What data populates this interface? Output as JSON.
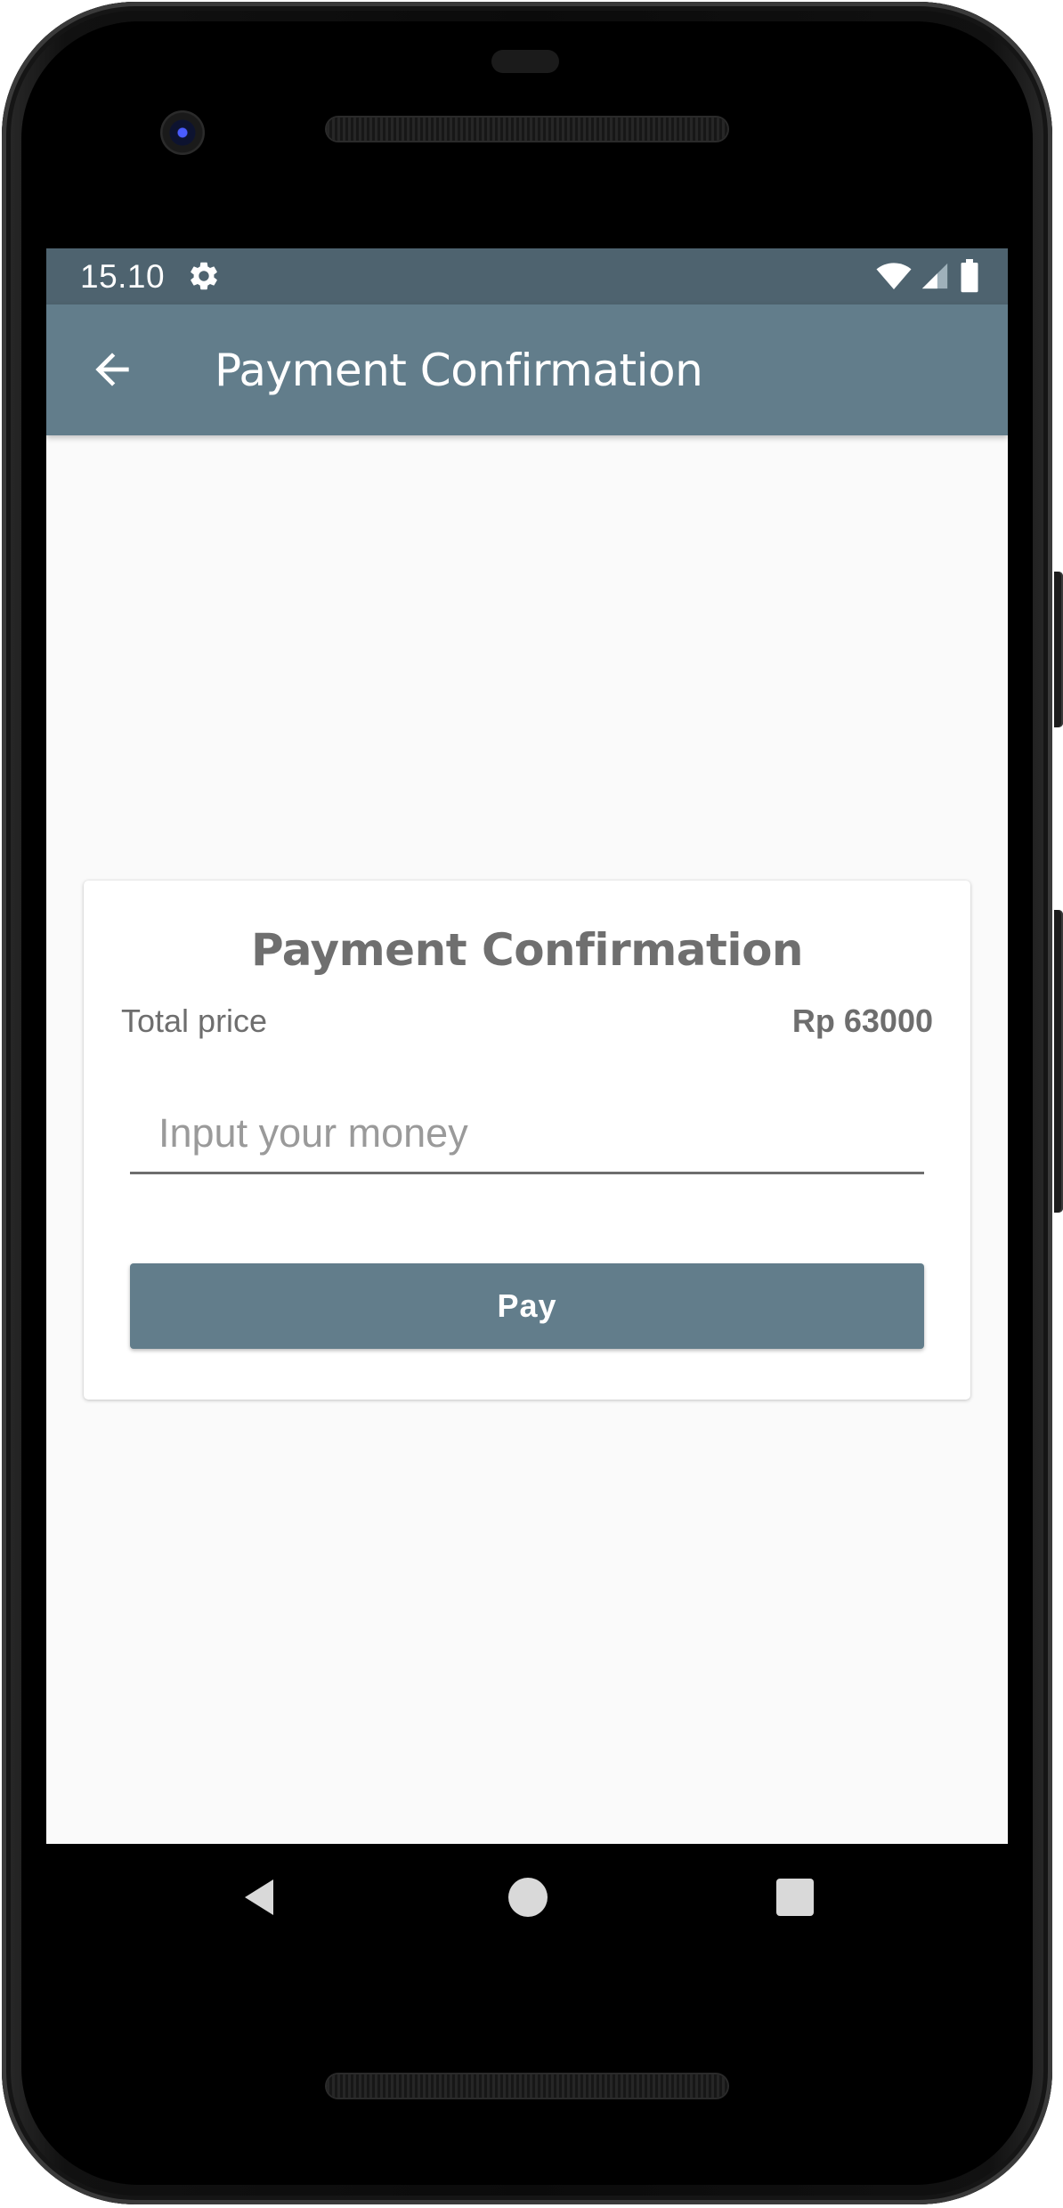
{
  "status_bar": {
    "time": "15.10",
    "left_icons": [
      "gear-icon"
    ],
    "right_icons": [
      "wifi-icon",
      "cell-signal-icon",
      "battery-icon"
    ]
  },
  "app_bar": {
    "back_icon": "arrow-left-icon",
    "title": "Payment Confirmation"
  },
  "card": {
    "title": "Payment Confirmation",
    "total_label": "Total price",
    "total_value": "Rp 63000",
    "money_input": {
      "value": "",
      "placeholder": "Input your money"
    },
    "pay_label": "Pay"
  },
  "nav_bar": {
    "icons": [
      "nav-back-icon",
      "nav-home-icon",
      "nav-recents-icon"
    ]
  },
  "colors": {
    "status_bar": "#4e636f",
    "app_bar": "#627d8b",
    "pay_button": "#627d8b",
    "screen_background": "#fafafa",
    "text_muted": "#6e6e6e"
  }
}
